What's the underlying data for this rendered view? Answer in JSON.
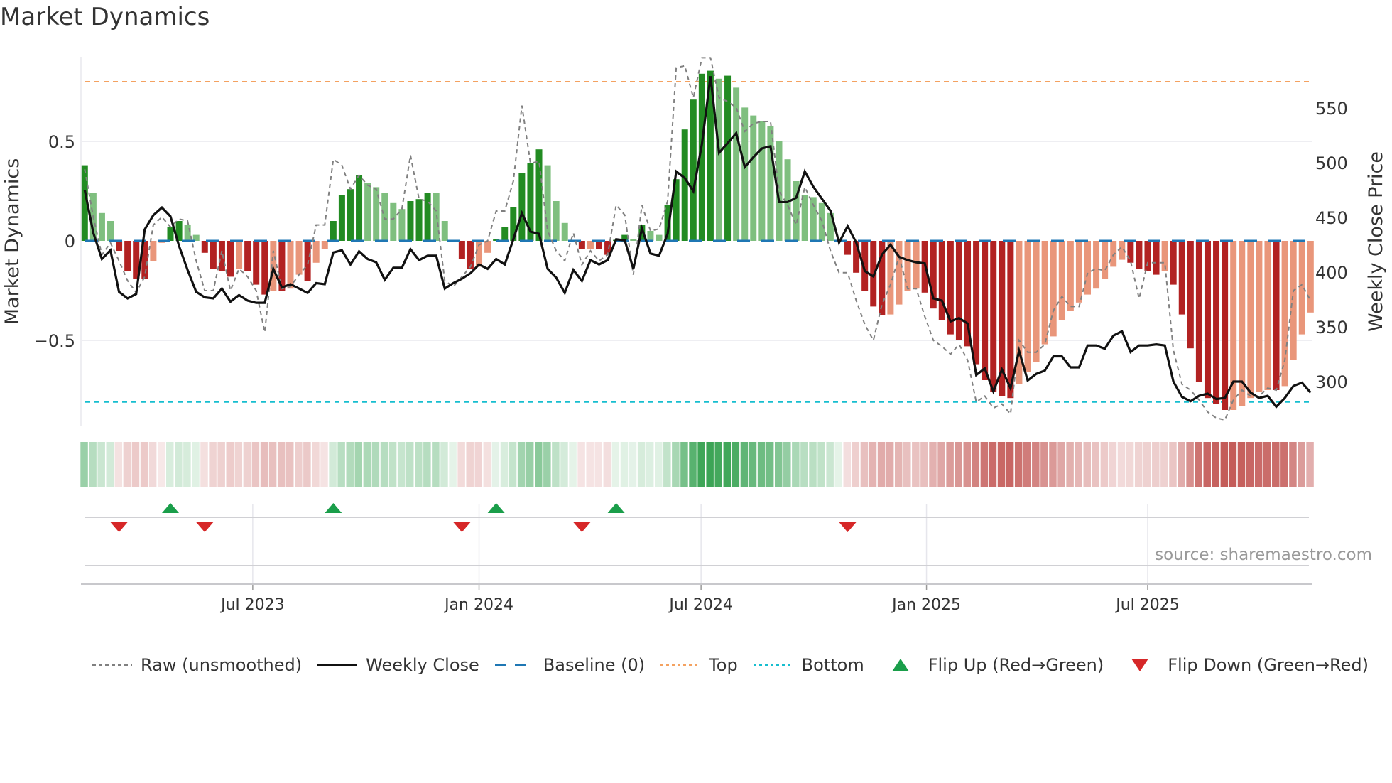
{
  "title": "Market Dynamics",
  "source": "source: sharemaestro.com",
  "chart_data": {
    "type": "bar",
    "title": "Market Dynamics",
    "ylabel": "Market Dynamics",
    "y2label": "Weekly Close Price",
    "ylim": [
      -0.96,
      0.98
    ],
    "y2lim": [
      260,
      595
    ],
    "yticks": [
      {
        "v": 0.5,
        "label": "0.5"
      },
      {
        "v": 0,
        "label": "0"
      },
      {
        "v": -0.5,
        "label": "−0.5"
      }
    ],
    "y2ticks": [
      {
        "v": 550,
        "label": "550"
      },
      {
        "v": 500,
        "label": "500"
      },
      {
        "v": 450,
        "label": "450"
      },
      {
        "v": 400,
        "label": "400"
      },
      {
        "v": 350,
        "label": "350"
      },
      {
        "v": 300,
        "label": "300"
      }
    ],
    "xticks": [
      {
        "week": 19.6,
        "label": "Jul 2023"
      },
      {
        "week": 46,
        "label": "Jan 2024"
      },
      {
        "week": 71.9,
        "label": "Jul 2024"
      },
      {
        "week": 98.2,
        "label": "Jan 2025"
      },
      {
        "week": 124,
        "label": "Jul 2025"
      }
    ],
    "top_level": 0.8,
    "bottom_level": -0.81,
    "baseline": 0,
    "values": [
      0.38,
      0.24,
      0.14,
      0.1,
      -0.05,
      -0.15,
      -0.19,
      -0.19,
      -0.1,
      -0.01,
      0.07,
      0.1,
      0.08,
      0.03,
      -0.06,
      -0.14,
      -0.15,
      -0.18,
      -0.14,
      -0.15,
      -0.22,
      -0.27,
      -0.25,
      -0.25,
      -0.24,
      -0.17,
      -0.2,
      -0.11,
      -0.04,
      0.1,
      0.23,
      0.26,
      0.33,
      0.29,
      0.27,
      0.24,
      0.19,
      0.16,
      0.2,
      0.21,
      0.24,
      0.24,
      0.1,
      0.005,
      -0.09,
      -0.14,
      -0.13,
      -0.06,
      0.01,
      0.07,
      0.17,
      0.34,
      0.39,
      0.46,
      0.38,
      0.2,
      0.09,
      0.005,
      -0.04,
      -0.04,
      -0.04,
      -0.07,
      0.005,
      0.03,
      0.01,
      0.08,
      0.05,
      0.03,
      0.18,
      0.31,
      0.56,
      0.71,
      0.84,
      0.855,
      0.815,
      0.83,
      0.77,
      0.67,
      0.63,
      0.6,
      0.575,
      0.5,
      0.41,
      0.3,
      0.23,
      0.22,
      0.19,
      0.14,
      0.005,
      -0.07,
      -0.16,
      -0.25,
      -0.33,
      -0.375,
      -0.37,
      -0.32,
      -0.25,
      -0.24,
      -0.26,
      -0.34,
      -0.4,
      -0.47,
      -0.5,
      -0.53,
      -0.62,
      -0.7,
      -0.76,
      -0.78,
      -0.79,
      -0.72,
      -0.66,
      -0.61,
      -0.52,
      -0.48,
      -0.4,
      -0.35,
      -0.31,
      -0.27,
      -0.24,
      -0.19,
      -0.13,
      -0.095,
      -0.11,
      -0.14,
      -0.15,
      -0.17,
      -0.15,
      -0.22,
      -0.37,
      -0.54,
      -0.71,
      -0.79,
      -0.82,
      -0.85,
      -0.85,
      -0.83,
      -0.79,
      -0.76,
      -0.75,
      -0.75,
      -0.73,
      -0.6,
      -0.47,
      -0.36
    ],
    "strong": [
      1,
      0,
      0,
      0,
      1,
      1,
      1,
      1,
      0,
      0,
      1,
      1,
      0,
      0,
      1,
      1,
      1,
      1,
      0,
      1,
      1,
      1,
      0,
      1,
      0,
      0,
      1,
      0,
      0,
      1,
      1,
      1,
      1,
      0,
      0,
      0,
      0,
      0,
      1,
      1,
      1,
      0,
      0,
      0,
      1,
      1,
      0,
      0,
      1,
      1,
      1,
      1,
      1,
      1,
      0,
      0,
      0,
      0,
      1,
      0,
      1,
      1,
      1,
      1,
      0,
      1,
      0,
      0,
      1,
      1,
      1,
      1,
      1,
      1,
      0,
      1,
      0,
      0,
      0,
      0,
      0,
      0,
      0,
      0,
      0,
      0,
      0,
      0,
      0,
      1,
      1,
      1,
      1,
      1,
      0,
      0,
      0,
      0,
      1,
      1,
      1,
      1,
      1,
      1,
      1,
      1,
      1,
      1,
      1,
      0,
      0,
      0,
      0,
      0,
      0,
      0,
      0,
      0,
      0,
      0,
      0,
      0,
      1,
      1,
      1,
      1,
      0,
      1,
      1,
      1,
      1,
      1,
      1,
      1,
      0,
      0,
      0,
      0,
      0,
      1,
      0,
      0,
      0,
      0
    ],
    "raw": [
      0.36,
      0.12,
      -0.07,
      -0.01,
      -0.1,
      -0.2,
      -0.26,
      -0.18,
      0.08,
      0.12,
      0.07,
      0.11,
      0.1,
      -0.1,
      -0.25,
      -0.25,
      -0.05,
      -0.25,
      -0.14,
      -0.18,
      -0.25,
      -0.46,
      -0.05,
      -0.24,
      -0.23,
      -0.17,
      -0.12,
      0.08,
      0.08,
      0.41,
      0.38,
      0.26,
      0.33,
      0.28,
      0.26,
      0.11,
      0.11,
      0.16,
      0.43,
      0.21,
      0.2,
      0.15,
      -0.2,
      -0.23,
      -0.18,
      -0.13,
      -0.02,
      0.0,
      0.15,
      0.15,
      0.3,
      0.68,
      0.39,
      0.4,
      0.05,
      -0.05,
      -0.1,
      0.04,
      -0.12,
      -0.05,
      -0.1,
      -0.07,
      0.18,
      0.13,
      -0.17,
      0.18,
      0.05,
      0.06,
      0.2,
      0.87,
      0.88,
      0.72,
      0.92,
      0.92,
      0.72,
      0.7,
      0.67,
      0.55,
      0.59,
      0.6,
      0.6,
      0.25,
      0.18,
      0.08,
      0.27,
      0.18,
      0.1,
      -0.05,
      -0.16,
      -0.16,
      -0.3,
      -0.42,
      -0.5,
      -0.32,
      -0.22,
      -0.08,
      -0.24,
      -0.24,
      -0.38,
      -0.5,
      -0.53,
      -0.57,
      -0.52,
      -0.6,
      -0.81,
      -0.78,
      -0.84,
      -0.82,
      -0.87,
      -0.5,
      -0.56,
      -0.56,
      -0.52,
      -0.35,
      -0.28,
      -0.33,
      -0.33,
      -0.16,
      -0.14,
      -0.15,
      -0.07,
      -0.03,
      -0.1,
      -0.29,
      -0.11,
      -0.11,
      -0.11,
      -0.55,
      -0.72,
      -0.75,
      -0.8,
      -0.86,
      -0.89,
      -0.9,
      -0.8,
      -0.75,
      -0.78,
      -0.78,
      -0.74,
      -0.75,
      -0.6,
      -0.25,
      -0.22,
      -0.3
    ],
    "close": [
      475,
      436,
      412,
      420,
      382,
      376,
      380,
      439,
      452,
      459,
      451,
      424,
      402,
      382,
      377,
      376,
      385,
      373,
      379,
      374,
      372,
      372,
      403,
      386,
      389,
      385,
      381,
      390,
      389,
      418,
      420,
      407,
      419,
      412,
      409,
      393,
      404,
      404,
      421,
      411,
      415,
      415,
      385,
      390,
      394,
      399,
      407,
      403,
      412,
      407,
      430,
      454,
      437,
      435,
      403,
      395,
      381,
      402,
      392,
      411,
      407,
      411,
      430,
      429,
      403,
      440,
      417,
      415,
      435,
      492,
      486,
      474,
      517,
      579,
      509,
      518,
      527,
      496,
      505,
      513,
      515,
      464,
      464,
      468,
      492,
      478,
      467,
      456,
      427,
      442,
      427,
      401,
      396,
      416,
      425,
      414,
      411,
      409,
      408,
      376,
      374,
      355,
      358,
      353,
      306,
      312,
      291,
      311,
      294,
      328,
      301,
      307,
      310,
      323,
      323,
      313,
      313,
      333,
      333,
      330,
      342,
      346,
      327,
      333,
      333,
      334,
      333,
      300,
      286,
      282,
      287,
      289,
      284,
      285,
      300,
      300,
      290,
      285,
      287,
      277,
      285,
      296,
      299,
      290
    ],
    "flip_up": [
      10,
      29,
      48,
      62
    ],
    "flip_down": [
      4,
      14,
      44,
      58,
      89
    ],
    "legend": [
      "Raw (unsmoothed)",
      "Weekly Close",
      "Baseline (0)",
      "Top",
      "Bottom",
      "Flip Up (Red→Green)",
      "Flip Down (Green→Red)"
    ],
    "legend_placement": "bottom",
    "colors": {
      "strong_up": "#228b22",
      "weak_up": "#7fbf7f",
      "strong_down": "#b22222",
      "weak_down": "#e9967a",
      "raw": "#808080",
      "close": "#111111",
      "baseline": "#1f77b4",
      "top": "#f4a261",
      "bottom": "#17becf",
      "flip_up": "#1a9e4a",
      "flip_down": "#d62728",
      "heat_up": "#2e9e4a",
      "heat_down": "#c0504d"
    }
  }
}
